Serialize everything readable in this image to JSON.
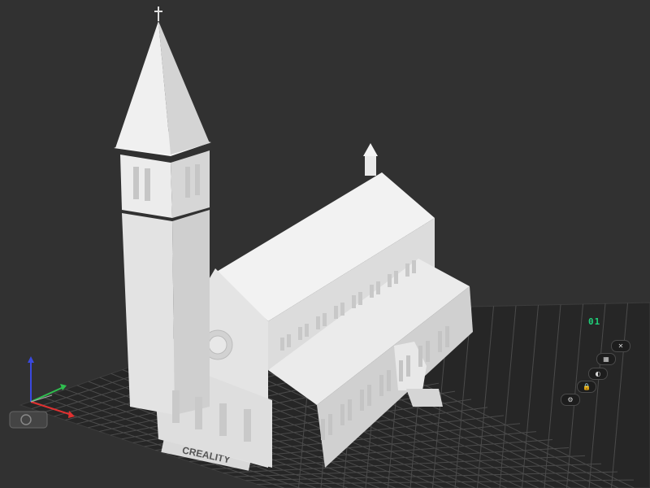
{
  "viewport": {
    "bed_brand": "CREALITY",
    "plate_label": "01",
    "plate_tools": [
      {
        "name": "close-plate-icon",
        "glyph": "✕"
      },
      {
        "name": "arrange-icon",
        "glyph": "▦"
      },
      {
        "name": "orient-icon",
        "glyph": "◐"
      },
      {
        "name": "lock-plate-icon",
        "glyph": "🔒"
      },
      {
        "name": "plate-settings-icon",
        "glyph": "⚙"
      }
    ]
  },
  "colors": {
    "background": "#313131",
    "bed": "#262626",
    "grid": "#4a4a4a",
    "model": "#eeeeee",
    "accent": "#1fd17a",
    "axis_x": "#e03030",
    "axis_y": "#2fbf4f",
    "axis_z": "#3a49e0"
  }
}
